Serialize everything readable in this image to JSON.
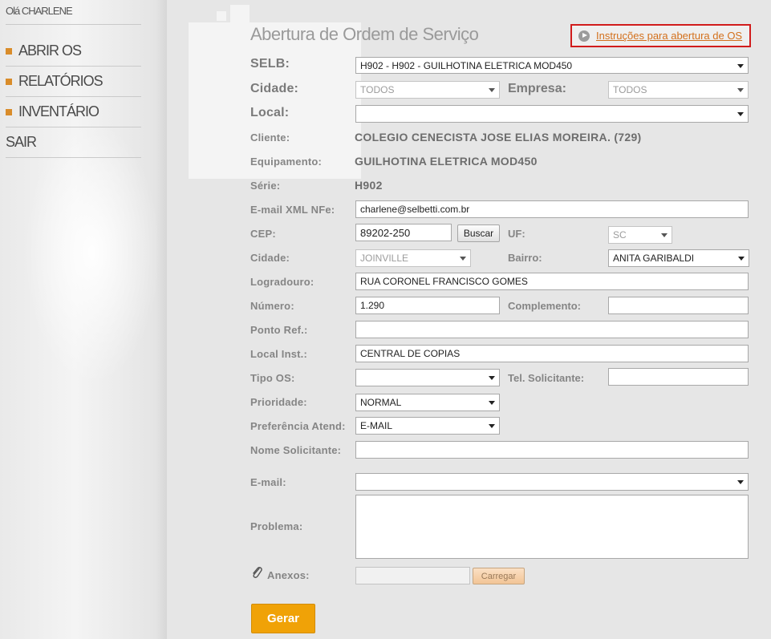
{
  "sidebar": {
    "greeting": "Olá CHARLENE",
    "items": [
      {
        "label": "ABRIR OS",
        "bullet": true
      },
      {
        "label": "RELATÓRIOS",
        "bullet": true
      },
      {
        "label": "INVENTÁRIO",
        "bullet": true
      },
      {
        "label": "SAIR",
        "bullet": false
      }
    ],
    "bullet_color": "#d98c2a"
  },
  "header": {
    "title": "Abertura de Ordem de Serviço",
    "instructions_link": "Instruções para abertura de OS",
    "highlight_color": "#d11c1c",
    "link_color": "#d3701c"
  },
  "form": {
    "selb": {
      "label": "SELB:",
      "value": "H902 - H902 - GUILHOTINA ELETRICA MOD450"
    },
    "cidade_top": {
      "label": "Cidade:",
      "value": "TODOS"
    },
    "empresa": {
      "label": "Empresa:",
      "value": "TODOS"
    },
    "local": {
      "label": "Local:",
      "value": ""
    },
    "cliente": {
      "label": "Cliente:",
      "value": "COLEGIO CENECISTA JOSE ELIAS MOREIRA. (729)"
    },
    "equipamento": {
      "label": "Equipamento:",
      "value": "GUILHOTINA ELETRICA MOD450"
    },
    "serie": {
      "label": "Série:",
      "value": "H902"
    },
    "email_xml": {
      "label": "E-mail XML NFe:",
      "value": "charlene@selbetti.com.br"
    },
    "cep": {
      "label": "CEP:",
      "value": "89202-250",
      "button": "Buscar"
    },
    "uf": {
      "label": "UF:",
      "value": "SC"
    },
    "cidade": {
      "label": "Cidade:",
      "value": "JOINVILLE"
    },
    "bairro": {
      "label": "Bairro:",
      "value": "ANITA GARIBALDI"
    },
    "logradouro": {
      "label": "Logradouro:",
      "value": "RUA CORONEL FRANCISCO GOMES"
    },
    "numero": {
      "label": "Número:",
      "value": "1.290"
    },
    "complemento": {
      "label": "Complemento:",
      "value": ""
    },
    "ponto_ref": {
      "label": "Ponto Ref.:",
      "value": ""
    },
    "local_inst": {
      "label": "Local Inst.:",
      "value": "CENTRAL DE COPIAS"
    },
    "tipo_os": {
      "label": "Tipo OS:",
      "value": ""
    },
    "tel_solicitante": {
      "label": "Tel. Solicitante:",
      "value": ""
    },
    "prioridade": {
      "label": "Prioridade:",
      "value": "NORMAL"
    },
    "preferencia": {
      "label": "Preferência Atend:",
      "value": "E-MAIL"
    },
    "nome_solicitante": {
      "label": "Nome Solicitante:",
      "value": ""
    },
    "email": {
      "label": "E-mail:",
      "value": ""
    },
    "problema": {
      "label": "Problema:",
      "value": ""
    },
    "anexos": {
      "label": "Anexos:",
      "button": "Carregar"
    },
    "gerar": "Gerar",
    "gerar_color": "#f0a207"
  }
}
